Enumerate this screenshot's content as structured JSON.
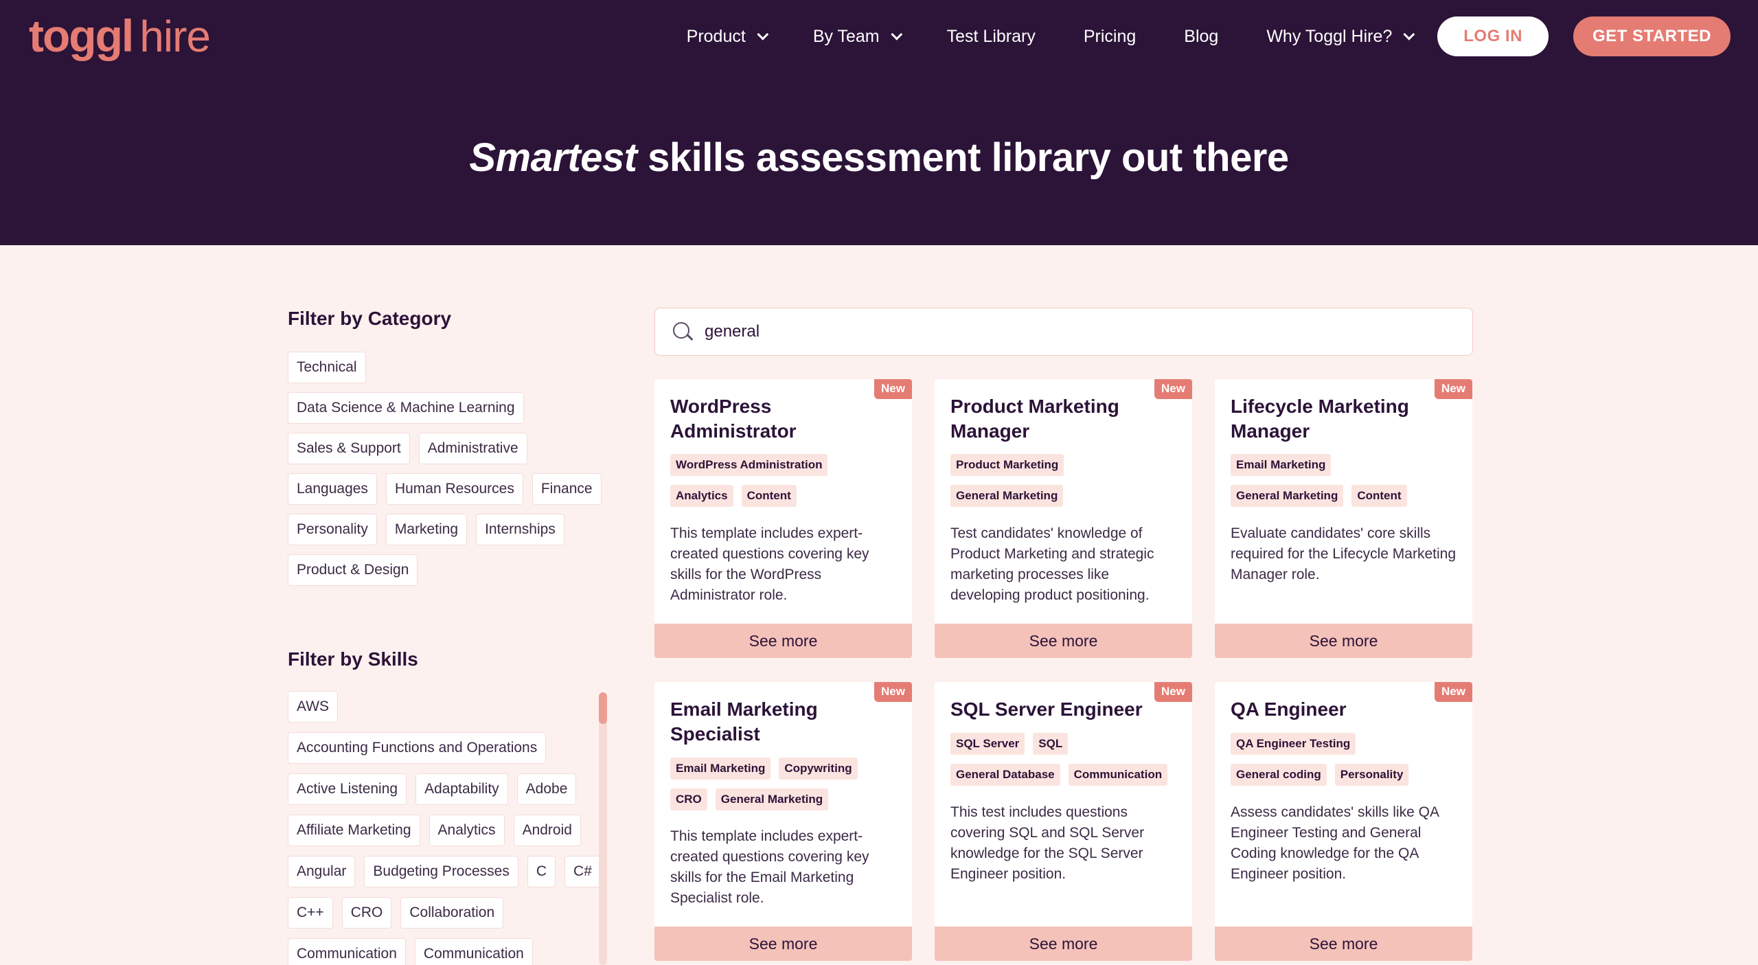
{
  "brand": {
    "name_part1": "toggl",
    "name_part2": "hire",
    "color": "#e57c73"
  },
  "nav": {
    "items": [
      {
        "label": "Product",
        "dropdown": true
      },
      {
        "label": "By Team",
        "dropdown": true
      },
      {
        "label": "Test Library",
        "dropdown": false
      },
      {
        "label": "Pricing",
        "dropdown": false
      },
      {
        "label": "Blog",
        "dropdown": false
      },
      {
        "label": "Why Toggl Hire?",
        "dropdown": true
      }
    ],
    "login": "LOG IN",
    "get_started": "GET STARTED"
  },
  "hero": {
    "title_em": "Smartest",
    "title_rest": " skills assessment library out there"
  },
  "filters": {
    "category_heading": "Filter by Category",
    "categories": [
      "Technical",
      "Data Science & Machine Learning",
      "Sales & Support",
      "Administrative",
      "Languages",
      "Human Resources",
      "Finance",
      "Personality",
      "Marketing",
      "Internships",
      "Product & Design"
    ],
    "skills_heading": "Filter by Skills",
    "skills": [
      "AWS",
      "Accounting Functions and Operations",
      "Active Listening",
      "Adaptability",
      "Adobe",
      "Affiliate Marketing",
      "Analytics",
      "Android",
      "Angular",
      "Budgeting Processes",
      "C",
      "C#",
      "C++",
      "CRO",
      "Collaboration",
      "Communication",
      "Communication"
    ]
  },
  "search": {
    "value": "general",
    "placeholder": "Search"
  },
  "cards": [
    {
      "badge": "New",
      "title": "WordPress Administrator",
      "tags": [
        "WordPress Administration",
        "Analytics",
        "Content"
      ],
      "description": "This template includes expert-created questions covering key skills for the WordPress Administrator role.",
      "button": "See more"
    },
    {
      "badge": "New",
      "title": "Product Marketing Manager",
      "tags": [
        "Product Marketing",
        "General Marketing"
      ],
      "description": "Test candidates' knowledge of Product Marketing and strategic marketing processes like developing product positioning.",
      "button": "See more"
    },
    {
      "badge": "New",
      "title": "Lifecycle Marketing Manager",
      "tags": [
        "Email Marketing",
        "General Marketing",
        "Content"
      ],
      "description": "Evaluate candidates' core skills required for the Lifecycle Marketing Manager role.",
      "button": "See more"
    },
    {
      "badge": "New",
      "title": "Email Marketing Specialist",
      "tags": [
        "Email Marketing",
        "Copywriting",
        "CRO",
        "General Marketing"
      ],
      "description": "This template includes expert-created questions covering key skills for the Email Marketing Specialist role.",
      "button": "See more"
    },
    {
      "badge": "New",
      "title": "SQL Server Engineer",
      "tags": [
        "SQL Server",
        "SQL",
        "General Database",
        "Communication"
      ],
      "description": "This test includes questions covering SQL and SQL Server knowledge for the SQL Server Engineer position.",
      "button": "See more"
    },
    {
      "badge": "New",
      "title": "QA Engineer",
      "tags": [
        "QA Engineer Testing",
        "General coding",
        "Personality"
      ],
      "description": "Assess candidates' skills like QA Engineer Testing and General Coding knowledge for the QA Engineer position.",
      "button": "See more"
    }
  ]
}
